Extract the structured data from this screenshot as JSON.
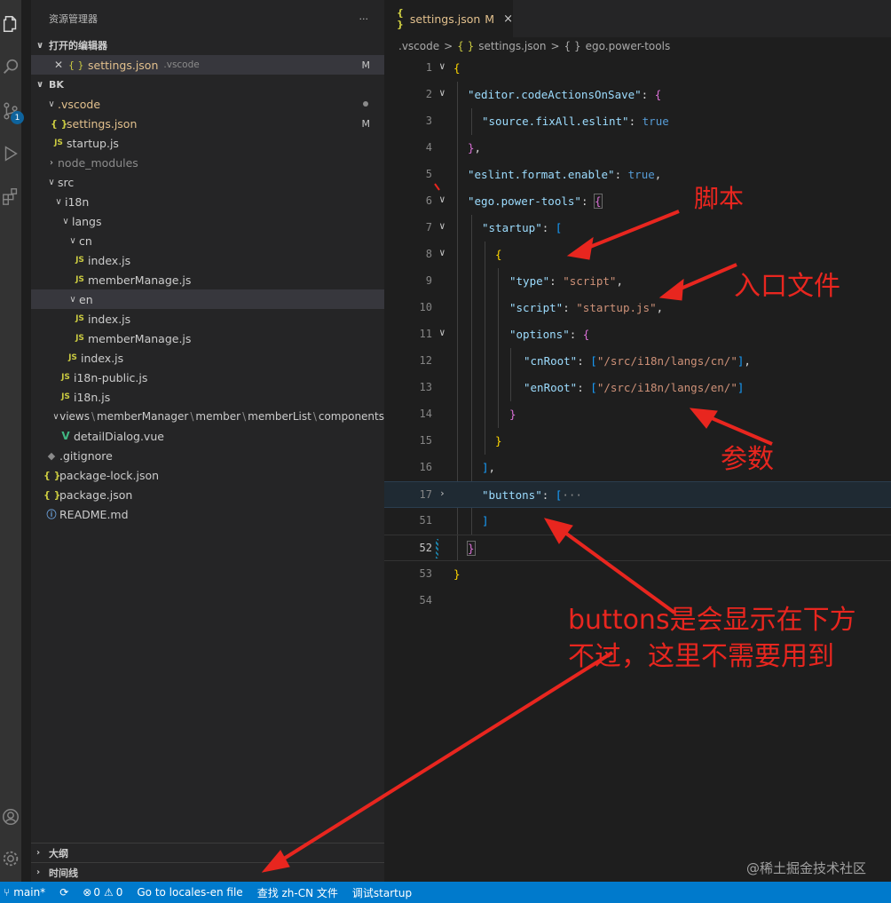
{
  "sidebar": {
    "title": "资源管理器",
    "more": "···",
    "open_editors_label": "打开的编辑器",
    "open_editor": {
      "name": "settings.json",
      "desc": ".vscode",
      "status": "M"
    },
    "root_label": "BK",
    "tree": [
      {
        "label": ".vscode",
        "chev": "∨",
        "icon": ""
      },
      {
        "label": "settings.json",
        "icon": "{ }",
        "status": "M"
      },
      {
        "label": "startup.js",
        "icon": "JS"
      },
      {
        "label": "node_modules",
        "chev": "›"
      },
      {
        "label": "src",
        "chev": "∨"
      },
      {
        "label": "i18n",
        "chev": "∨"
      },
      {
        "label": "langs",
        "chev": "∨"
      },
      {
        "label": "cn",
        "chev": "∨"
      },
      {
        "label": "index.js",
        "icon": "JS"
      },
      {
        "label": "memberManage.js",
        "icon": "JS"
      },
      {
        "label": "en",
        "chev": "∨"
      },
      {
        "label": "index.js",
        "icon": "JS"
      },
      {
        "label": "memberManage.js",
        "icon": "JS"
      },
      {
        "label": "index.js",
        "icon": "JS"
      },
      {
        "label": "i18n-public.js",
        "icon": "JS"
      },
      {
        "label": "i18n.js",
        "icon": "JS"
      },
      {
        "label": "views",
        "chev": "∨"
      },
      {
        "label": "memberManager",
        "chev": ""
      },
      {
        "label": "member",
        "chev": ""
      },
      {
        "label": "memberList",
        "chev": ""
      },
      {
        "label": "components",
        "chev": ""
      },
      {
        "label": "detailDialog.vue",
        "icon": "V"
      },
      {
        "label": ".gitignore",
        "icon": "◆"
      },
      {
        "label": "package-lock.json",
        "icon": "{ }"
      },
      {
        "label": "package.json",
        "icon": "{ }"
      },
      {
        "label": "README.md",
        "icon": "ⓘ"
      }
    ],
    "outline_label": "大纲",
    "timeline_label": "时间线"
  },
  "activity": {
    "scm_badge": "1"
  },
  "editor": {
    "tab_label": "settings.json",
    "tab_status": "M",
    "tab_close": "×",
    "breadcrumb": [
      ".vscode",
      ">",
      "{ }",
      "settings.json",
      ">",
      "{ }",
      "ego.power-tools"
    ],
    "line_numbers": [
      "1",
      "2",
      "3",
      "4",
      "5",
      "6",
      "7",
      "8",
      "9",
      "10",
      "11",
      "12",
      "13",
      "14",
      "15",
      "16",
      "17",
      "51",
      "52",
      "53",
      "54"
    ],
    "code": {
      "l2_key": "\"editor.codeActionsOnSave\"",
      "l3_key": "\"source.fixAll.eslint\"",
      "l3_val": "true",
      "l5_key": "\"eslint.format.enable\"",
      "l5_val": "true",
      "l6_key": "\"ego.power-tools\"",
      "l7_key": "\"startup\"",
      "l9_key": "\"type\"",
      "l9_val": "\"script\"",
      "l10_key": "\"script\"",
      "l10_val": "\"startup.js\"",
      "l11_key": "\"options\"",
      "l12_key": "\"cnRoot\"",
      "l12_val": "\"/src/i18n/langs/cn/\"",
      "l13_key": "\"enRoot\"",
      "l13_val": "\"/src/i18n/langs/en/\"",
      "l17_key": "\"buttons\"",
      "ellipsis": "···"
    }
  },
  "annotations": {
    "script": "脚本",
    "entry": "入口文件",
    "params": "参数",
    "buttons_line1": "buttons是会显示在下方",
    "buttons_line2": "不过，这里不需要用到",
    "color": "#e8261f"
  },
  "status": {
    "branch": "main*",
    "errors": "0",
    "warnings": "0",
    "item1": "Go to locales-en file",
    "item2": "查找 zh-CN 文件",
    "item3": "调试startup"
  },
  "watermark": "@稀土掘金技术社区"
}
